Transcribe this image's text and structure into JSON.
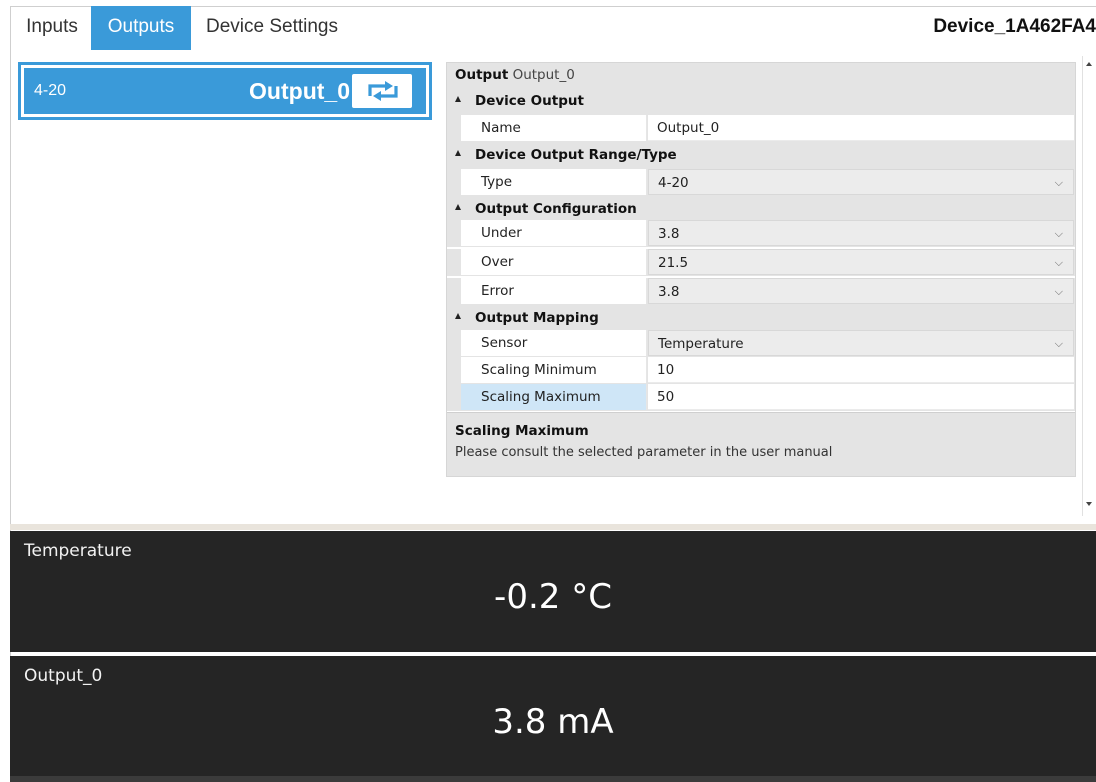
{
  "tabs": [
    {
      "label": "Inputs",
      "active": false
    },
    {
      "label": "Outputs",
      "active": true
    },
    {
      "label": "Device Settings",
      "active": false
    }
  ],
  "device_name": "Device_1A462FA4",
  "output_list": {
    "items": [
      {
        "range": "4-20",
        "name": "Output_0",
        "icon": "swap-icon",
        "selected": true
      }
    ]
  },
  "property_grid": {
    "header_label": "Output",
    "header_value": "Output_0",
    "categories": {
      "device_output": {
        "title": "Device Output",
        "name_label": "Name",
        "name_value": "Output_0"
      },
      "range_type": {
        "title": "Device Output Range/Type",
        "type_label": "Type",
        "type_value": "4-20"
      },
      "configuration": {
        "title": "Output Configuration",
        "under_label": "Under",
        "under_value": "3.8",
        "over_label": "Over",
        "over_value": "21.5",
        "error_label": "Error",
        "error_value": "3.8"
      },
      "mapping": {
        "title": "Output Mapping",
        "sensor_label": "Sensor",
        "sensor_value": "Temperature",
        "scaling_min_label": "Scaling Minimum",
        "scaling_min_value": "10",
        "scaling_max_label": "Scaling Maximum",
        "scaling_max_value": "50"
      }
    },
    "description": {
      "title": "Scaling Maximum",
      "text": "Please consult the selected parameter in the user manual"
    }
  },
  "readouts": {
    "temperature": {
      "title": "Temperature",
      "value": "-0.2 °C"
    },
    "output": {
      "title": "Output_0",
      "value": "3.8 mA"
    }
  },
  "colors": {
    "accent": "#3a9ad9",
    "panel_background": "#252525",
    "selected_row": "#cfe6f7"
  }
}
